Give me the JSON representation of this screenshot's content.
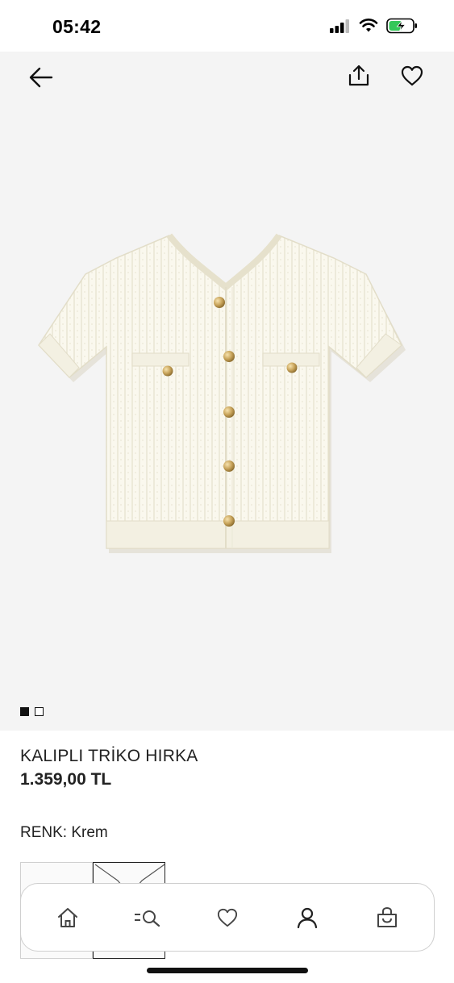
{
  "status_bar": {
    "time": "05:42",
    "icons": [
      "cellular-signal-icon",
      "wifi-icon",
      "battery-charging-icon"
    ],
    "battery_color": "#34c759"
  },
  "navigation": {
    "icons": [
      "back-arrow-icon",
      "share-icon",
      "heart-icon"
    ]
  },
  "product": {
    "image_icon": "cardigan-icon",
    "image_count": 2,
    "active_image": 1,
    "title": "KALIPLI TRİKO HIRKA",
    "price": "1.359,00 TL",
    "color_label": "RENK: Krem"
  },
  "tab_bar": {
    "items": [
      "home-icon",
      "search-icon",
      "heart-icon",
      "account-icon",
      "shopping-bag-icon"
    ]
  },
  "colors": {
    "image_background": "#f4f4f4",
    "garment": "#faf8ee",
    "button_gold": "#c9a55c",
    "text": "#222222"
  }
}
